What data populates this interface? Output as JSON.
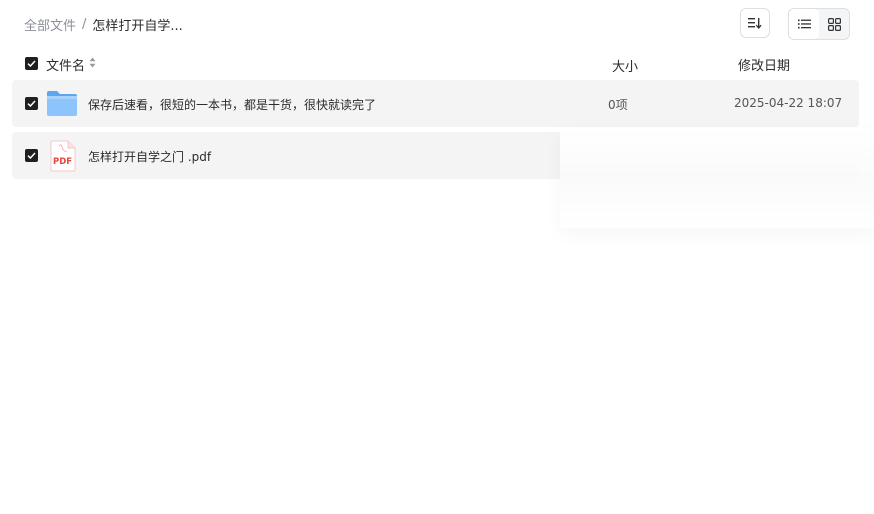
{
  "breadcrumb": {
    "root": "全部文件",
    "separator": "/",
    "current": "怎样打开自学..."
  },
  "toolbar": {
    "sort_icon": "sort-list-icon",
    "view_list_icon": "list-view-icon",
    "view_grid_icon": "grid-view-icon",
    "active_view": "list"
  },
  "table": {
    "columns": {
      "name": "文件名",
      "size": "大小",
      "date": "修改日期"
    },
    "rows": [
      {
        "type": "folder",
        "icon": "folder-icon",
        "name": "保存后速看，很短的一本书，都是干货，很快就读完了",
        "size": "0项",
        "date": "2025-04-22 18:07",
        "checked": true
      },
      {
        "type": "pdf",
        "icon": "pdf-file-icon",
        "icon_text": "PDF",
        "name": "怎样打开自学之门 .pdf",
        "size": "",
        "date": "",
        "checked": true
      }
    ]
  },
  "colors": {
    "accent": "#1f1f1f",
    "row_bg": "#f4f4f5",
    "folder": "#6fb1f5",
    "pdf_red": "#e2463f"
  }
}
